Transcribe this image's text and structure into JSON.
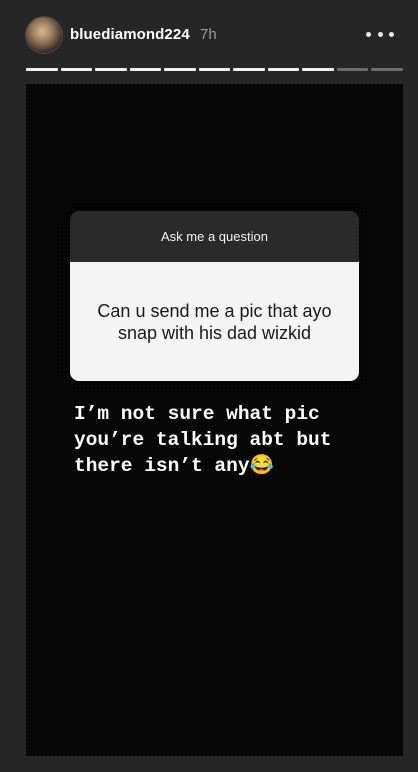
{
  "header": {
    "username": "bluediamond224",
    "time": "7h",
    "more_icon": "more-horizontal-icon"
  },
  "progress": {
    "segments_total": 11,
    "segments_done": 9
  },
  "question_sticker": {
    "prompt": "Ask me a question",
    "question": "Can u send me a pic that ayo snap with his dad wizkid"
  },
  "reply": {
    "text": "I’m not sure what pic you’re talking abt but there isn’t any😂"
  }
}
